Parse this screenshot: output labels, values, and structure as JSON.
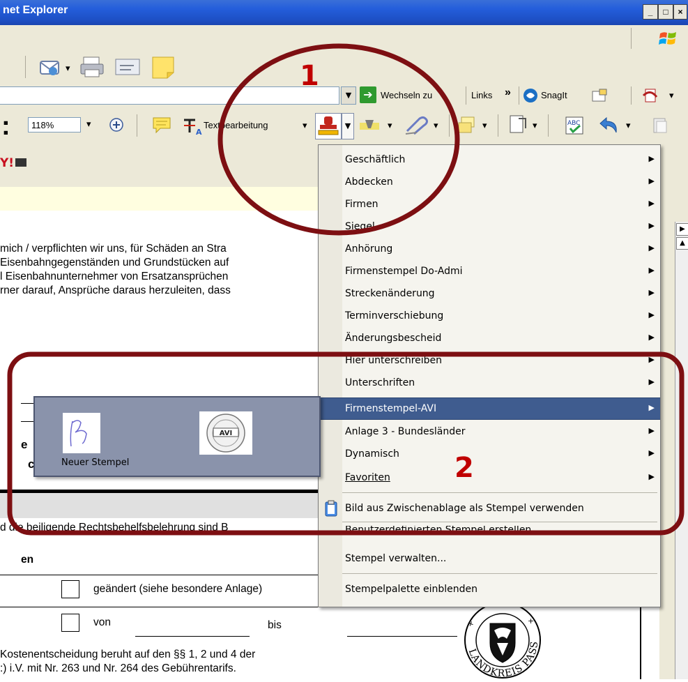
{
  "window": {
    "title": "net Explorer",
    "btn_min": "_",
    "btn_max": "□",
    "btn_close": "×"
  },
  "addressbar": {
    "go_label": "Wechseln zu",
    "links_label": "Links",
    "links_chevron": "»",
    "snagit_label": "SnagIt"
  },
  "pdf_toolbar": {
    "zoom_value": "118%",
    "textedit_label": "Textbearbeitung",
    "colon": ":"
  },
  "document": {
    "lines": [
      "mich / verpflichten wir uns, für Schäden an Stra",
      "Eisenbahngegenständen und Grundstücken auf",
      "l Eisenbahnunternehmer von Ersatzansprüchen",
      "rner darauf, Ansprüche daraus herzuleiten, dass"
    ],
    "line_e": "e",
    "line_c": "c",
    "rechtsbehelf": "d die beiligende Rechtsbehelfsbelehrung sind B",
    "en": "en",
    "checkbox1_label": "geändert (siehe besondere Anlage)",
    "checkbox2_label": "von",
    "bis_label": "bis",
    "kosten_line1": "Kostenentscheidung beruht auf den §§ 1, 2 und 4 der",
    "kosten_line2": ":) i.V. mit Nr. 263 und Nr. 264 des Gebührentarifs.",
    "seal_text": "LANDKREIS PASSAU"
  },
  "stamp_menu": {
    "items": [
      {
        "label": "Geschäftlich"
      },
      {
        "label": "Abdecken"
      },
      {
        "label": "Firmen"
      },
      {
        "label": "Siegel"
      },
      {
        "label": "Anhörung"
      },
      {
        "label": "Firmenstempel Do-Admi"
      },
      {
        "label": "Streckenänderung"
      },
      {
        "label": "Terminverschiebung"
      },
      {
        "label": "Änderungsbescheid"
      },
      {
        "label": "Hier unterschreiben"
      },
      {
        "label": "Unterschriften"
      },
      {
        "label": "Firmenstempel-AVI"
      },
      {
        "label": "Anlage 3 - Bundesländer"
      },
      {
        "label": "Dynamisch"
      },
      {
        "label": "Favoriten"
      }
    ],
    "clipboard_label": "Bild aus Zwischenablage als Stempel verwenden",
    "custom_label": "Benutzerdefinierten Stempel erstellen...",
    "manage_label": "Stempel verwalten...",
    "palette_label": "Stempelpalette einblenden"
  },
  "submenu": {
    "new_stamp_label": "Neuer Stempel",
    "avi_logo_text": "AVI"
  },
  "annotations": {
    "marker1": "1",
    "marker2": "2",
    "color": "#7d0f12"
  }
}
